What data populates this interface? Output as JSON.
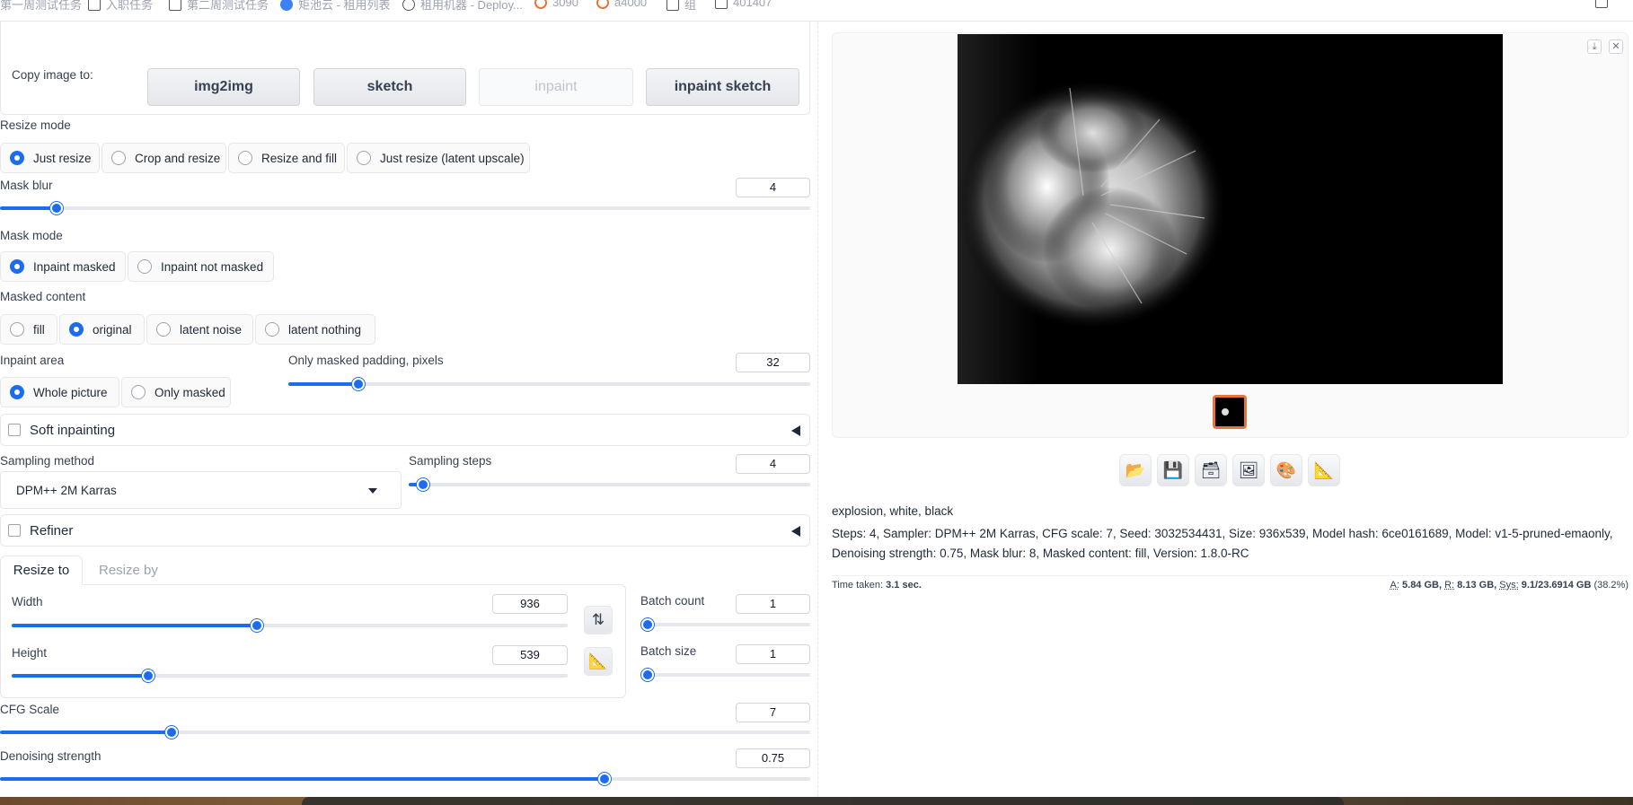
{
  "bookmarks": [
    {
      "label": "第一周测试任务",
      "icon": "none"
    },
    {
      "label": "入职任务",
      "icon": "folder-icon"
    },
    {
      "label": "第二周测试任务",
      "icon": "folder-icon"
    },
    {
      "label": "矩池云 - 租用列表",
      "icon": "cloud-icon"
    },
    {
      "label": "租用机器 - Deploy...",
      "icon": "globe-icon"
    },
    {
      "label": "3090",
      "icon": "orange-icon"
    },
    {
      "label": "a4000",
      "icon": "orange-icon"
    },
    {
      "label": "组",
      "icon": "folder-icon"
    },
    {
      "label": "401407",
      "icon": "folder-icon"
    }
  ],
  "copy_image": {
    "label": "Copy image to:",
    "buttons": [
      "img2img",
      "sketch",
      "inpaint",
      "inpaint sketch"
    ]
  },
  "resize_mode": {
    "label": "Resize mode",
    "options": [
      "Just resize",
      "Crop and resize",
      "Resize and fill",
      "Just resize (latent upscale)"
    ],
    "selected": "Just resize"
  },
  "mask_blur": {
    "label": "Mask blur",
    "value": "4",
    "min": 0,
    "max": 64
  },
  "mask_mode": {
    "label": "Mask mode",
    "options": [
      "Inpaint masked",
      "Inpaint not masked"
    ],
    "selected": "Inpaint masked"
  },
  "masked_content": {
    "label": "Masked content",
    "options": [
      "fill",
      "original",
      "latent noise",
      "latent nothing"
    ],
    "selected": "original"
  },
  "inpaint_area": {
    "label": "Inpaint area",
    "options": [
      "Whole picture",
      "Only masked"
    ],
    "selected": "Whole picture"
  },
  "padding": {
    "label": "Only masked padding, pixels",
    "value": "32",
    "min": 0,
    "max": 256
  },
  "soft_inpainting": {
    "label": "Soft inpainting"
  },
  "sampling_method": {
    "label": "Sampling method",
    "value": "DPM++ 2M Karras"
  },
  "sampling_steps": {
    "label": "Sampling steps",
    "value": "4",
    "min": 1,
    "max": 150
  },
  "refiner": {
    "label": "Refiner"
  },
  "size_tabs": {
    "tabs": [
      "Resize to",
      "Resize by"
    ],
    "selected": "Resize to"
  },
  "width": {
    "label": "Width",
    "value": "936",
    "min": 64,
    "max": 2048
  },
  "height": {
    "label": "Height",
    "value": "539",
    "min": 64,
    "max": 2048
  },
  "batch_count": {
    "label": "Batch count",
    "value": "1",
    "min": 1,
    "max": 100
  },
  "batch_size": {
    "label": "Batch size",
    "value": "1",
    "min": 1,
    "max": 8
  },
  "cfg_scale": {
    "label": "CFG Scale",
    "value": "7",
    "min": 1,
    "max": 30
  },
  "denoising": {
    "label": "Denoising strength",
    "value": "0.75",
    "min": 0,
    "max": 1
  },
  "output": {
    "prompt": "explosion, white, black",
    "params": "Steps: 4, Sampler: DPM++ 2M Karras, CFG scale: 7, Seed: 3032534431, Size: 936x539, Model hash: 6ce0161689, Model: v1-5-pruned-emaonly, Denoising strength: 0.75, Mask blur: 8, Masked content: fill, Version: 1.8.0-RC",
    "time_label": "Time taken:",
    "time_value": "3.1 sec.",
    "mem_a_label": "A:",
    "mem_a": "5.84 GB,",
    "mem_r_label": "R:",
    "mem_r": "8.13 GB,",
    "mem_sys_label": "Sys:",
    "mem_sys": "9.1/23.6914 GB",
    "mem_pct": "(38.2%)",
    "tools": [
      "folder-icon",
      "save-icon",
      "zip-icon",
      "image-icon",
      "palette-icon",
      "ruler-icon"
    ]
  },
  "colors": {
    "accent": "#1d6cf0",
    "thumb_border": "#e8743b"
  }
}
